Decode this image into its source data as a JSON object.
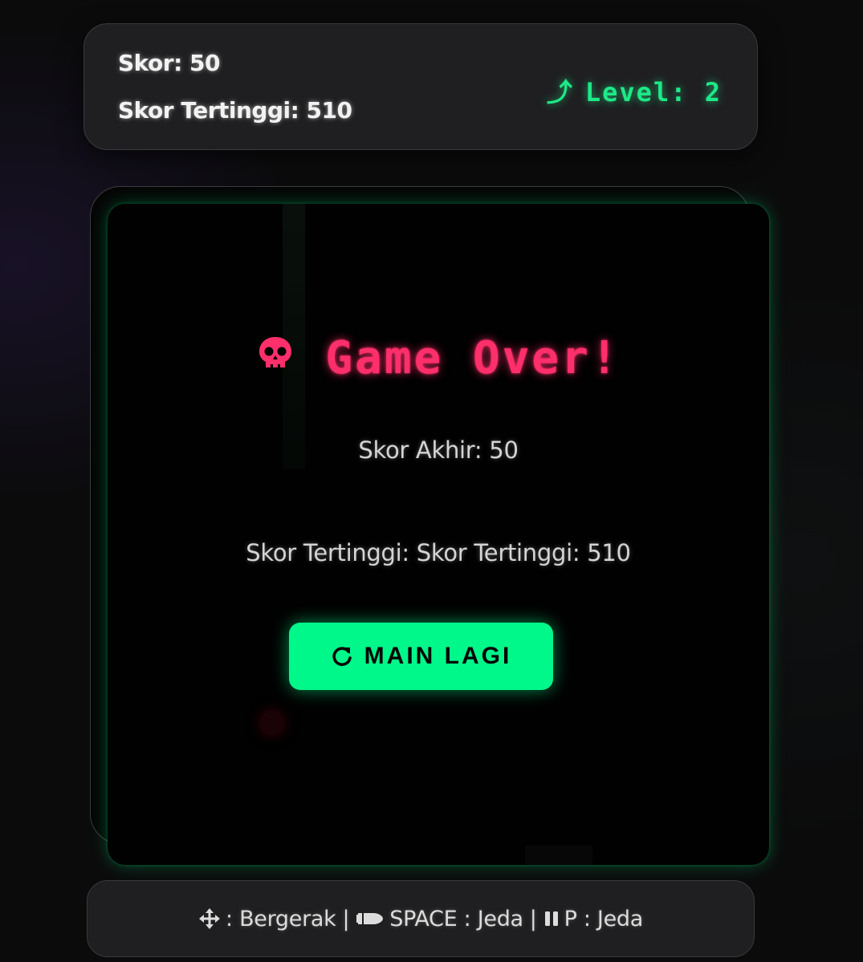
{
  "hud": {
    "score": "Skor: 50",
    "high_score": "Skor Tertinggi: 510",
    "level_arrow": "⤴",
    "level": "Level: 2"
  },
  "game_over": {
    "title": "Game Over!",
    "final_score": "Skor Akhir: 50",
    "high_score": "Skor Tertinggi: Skor Tertinggi: 510",
    "play_again_label": "MAIN LAGI"
  },
  "controls": {
    "move_label": ": Bergerak",
    "separator": "|",
    "space_label": "SPACE : Jeda",
    "pause_label": "P : Jeda"
  },
  "colors": {
    "accent_green": "#00f78a",
    "game_over_red": "#ff2f6b",
    "panel_bg": "#1f1f21"
  },
  "icons": [
    "skull-icon",
    "redo-icon",
    "arrows-move-icon",
    "bullet-icon",
    "pause-icon"
  ]
}
